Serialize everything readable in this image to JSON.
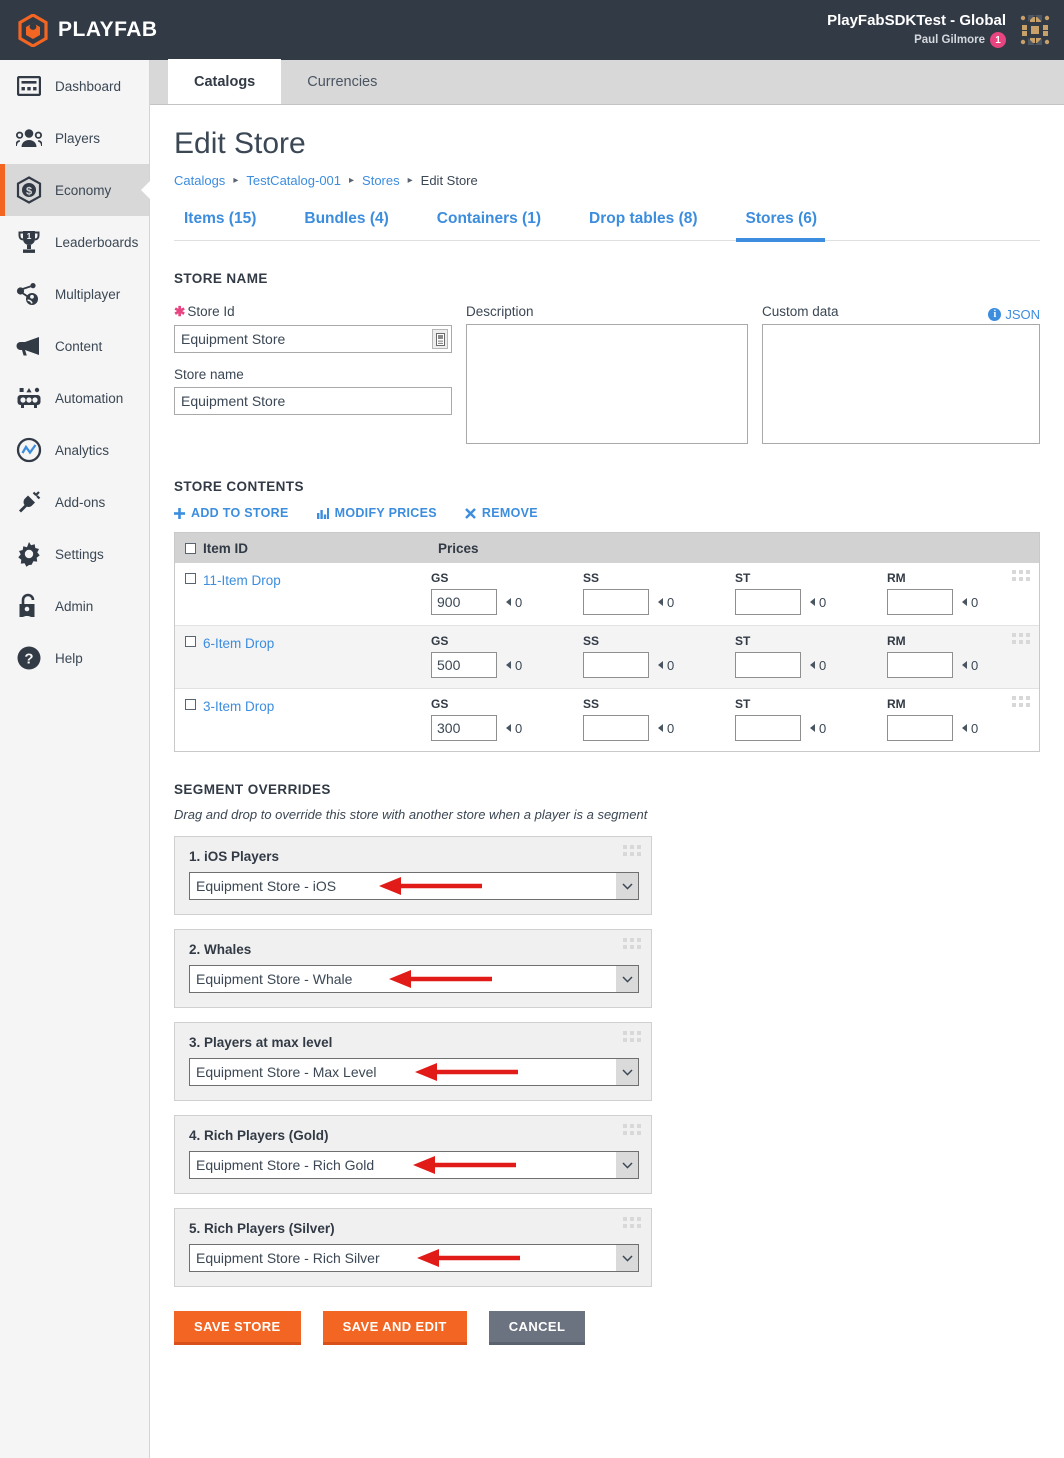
{
  "header": {
    "brand": "PLAYFAB",
    "brand_logo_icon": "playfab-hex-logo",
    "studio_title": "PlayFabSDKTest - Global",
    "user_name": "Paul Gilmore",
    "notification_count": "1",
    "apps_grid_icon": "apps-grid-icon",
    "accent_orange": "#f26522",
    "bar_bg": "#323a45"
  },
  "sidebar": {
    "items": [
      {
        "label": "Dashboard",
        "icon": "dashboard-icon",
        "active": false
      },
      {
        "label": "Players",
        "icon": "players-icon",
        "active": false
      },
      {
        "label": "Economy",
        "icon": "economy-icon",
        "active": true
      },
      {
        "label": "Leaderboards",
        "icon": "trophy-icon",
        "active": false
      },
      {
        "label": "Multiplayer",
        "icon": "multiplayer-icon",
        "active": false
      },
      {
        "label": "Content",
        "icon": "megaphone-icon",
        "active": false
      },
      {
        "label": "Automation",
        "icon": "automation-icon",
        "active": false
      },
      {
        "label": "Analytics",
        "icon": "analytics-icon",
        "active": false
      },
      {
        "label": "Add-ons",
        "icon": "plug-icon",
        "active": false
      },
      {
        "label": "Settings",
        "icon": "gear-icon",
        "active": false
      },
      {
        "label": "Admin",
        "icon": "lock-user-icon",
        "active": false
      },
      {
        "label": "Help",
        "icon": "help-icon",
        "active": false
      }
    ]
  },
  "tabstrip": {
    "tabs": [
      {
        "label": "Catalogs",
        "active": true
      },
      {
        "label": "Currencies",
        "active": false
      }
    ]
  },
  "page": {
    "title": "Edit Store",
    "breadcrumb": [
      {
        "label": "Catalogs",
        "link": true
      },
      {
        "label": "TestCatalog-001",
        "link": true
      },
      {
        "label": "Stores",
        "link": true
      },
      {
        "label": "Edit Store",
        "link": false
      }
    ],
    "breadcrumb_separator": "▸"
  },
  "subtabs": [
    {
      "label": "Items (15)",
      "active": false
    },
    {
      "label": "Bundles (4)",
      "active": false
    },
    {
      "label": "Containers (1)",
      "active": false
    },
    {
      "label": "Drop tables (8)",
      "active": false
    },
    {
      "label": "Stores (6)",
      "active": true
    }
  ],
  "store_name_section": {
    "heading": "STORE NAME",
    "store_id": {
      "label": "Store Id",
      "required_marker": "✱",
      "value": "Equipment Store",
      "inner_button_icon": "id-card-icon"
    },
    "store_name": {
      "label": "Store name",
      "value": "Equipment Store"
    },
    "description": {
      "label": "Description",
      "value": "",
      "placeholder": ""
    },
    "custom_data": {
      "label": "Custom data",
      "value": "",
      "placeholder": "",
      "json_link": "JSON",
      "json_info_icon": "info-circle-icon",
      "json_info_glyph": "i"
    }
  },
  "store_contents_section": {
    "heading": "STORE CONTENTS",
    "actions": [
      {
        "label": "ADD TO STORE",
        "icon": "plus-icon",
        "glyph": "✚"
      },
      {
        "label": "MODIFY PRICES",
        "icon": "bar-chart-icon",
        "glyph": "▐"
      },
      {
        "label": "REMOVE",
        "icon": "close-x-icon",
        "glyph": "✖"
      }
    ],
    "columns": [
      "Item ID",
      "Prices"
    ],
    "price_currencies": [
      "GS",
      "SS",
      "ST",
      "RM"
    ],
    "rows": [
      {
        "item_id": "11-Item Drop",
        "checked": false,
        "prices": [
          {
            "currency": "GS",
            "value": "900",
            "secondary": "0"
          },
          {
            "currency": "SS",
            "value": "",
            "secondary": "0"
          },
          {
            "currency": "ST",
            "value": "",
            "secondary": "0"
          },
          {
            "currency": "RM",
            "value": "",
            "secondary": "0"
          }
        ]
      },
      {
        "item_id": "6-Item Drop",
        "checked": false,
        "prices": [
          {
            "currency": "GS",
            "value": "500",
            "secondary": "0"
          },
          {
            "currency": "SS",
            "value": "",
            "secondary": "0"
          },
          {
            "currency": "ST",
            "value": "",
            "secondary": "0"
          },
          {
            "currency": "RM",
            "value": "",
            "secondary": "0"
          }
        ]
      },
      {
        "item_id": "3-Item Drop",
        "checked": false,
        "prices": [
          {
            "currency": "GS",
            "value": "300",
            "secondary": "0"
          },
          {
            "currency": "SS",
            "value": "",
            "secondary": "0"
          },
          {
            "currency": "ST",
            "value": "",
            "secondary": "0"
          },
          {
            "currency": "RM",
            "value": "",
            "secondary": "0"
          }
        ]
      }
    ]
  },
  "segment_overrides_section": {
    "heading": "SEGMENT OVERRIDES",
    "note": "Drag and drop to override this store with another store when a player is a segment",
    "annotation_arrow_color": "#e01b18",
    "cards": [
      {
        "title": "1. iOS Players",
        "selected": "Equipment Store - iOS",
        "annotated": true
      },
      {
        "title": "2. Whales",
        "selected": "Equipment Store - Whale",
        "annotated": true
      },
      {
        "title": "3. Players at max level",
        "selected": "Equipment Store - Max Level",
        "annotated": true
      },
      {
        "title": "4. Rich Players (Gold)",
        "selected": "Equipment Store - Rich Gold",
        "annotated": true
      },
      {
        "title": "5. Rich Players (Silver)",
        "selected": "Equipment Store - Rich Silver",
        "annotated": true
      }
    ]
  },
  "footer_buttons": [
    {
      "label": "SAVE STORE",
      "style": "primary"
    },
    {
      "label": "SAVE AND EDIT",
      "style": "primary"
    },
    {
      "label": "CANCEL",
      "style": "cancel"
    }
  ]
}
